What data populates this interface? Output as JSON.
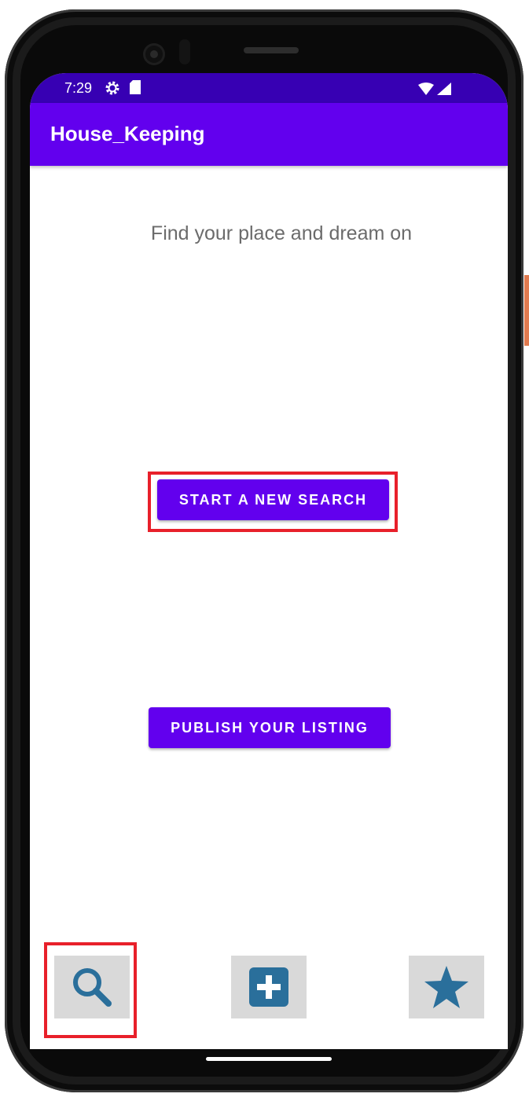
{
  "status_bar": {
    "time": "7:29",
    "icons": [
      "settings-gear-icon",
      "sd-card-icon",
      "wifi-icon",
      "cell-signal-icon"
    ]
  },
  "app_bar": {
    "title": "House_Keeping",
    "color": "#6200ee"
  },
  "main": {
    "subtitle": "Find your place and dream on",
    "search_button_label": "START A NEW SEARCH",
    "publish_button_label": "PUBLISH YOUR LISTING"
  },
  "bottom_nav": {
    "items": [
      {
        "icon": "search-icon"
      },
      {
        "icon": "add-icon"
      },
      {
        "icon": "star-icon"
      }
    ],
    "icon_color": "#2a6f9b"
  },
  "colors": {
    "status_bar": "#3700b3",
    "primary": "#6200ee",
    "highlight": "#e8202a",
    "tab_background": "#d9d9d9"
  }
}
